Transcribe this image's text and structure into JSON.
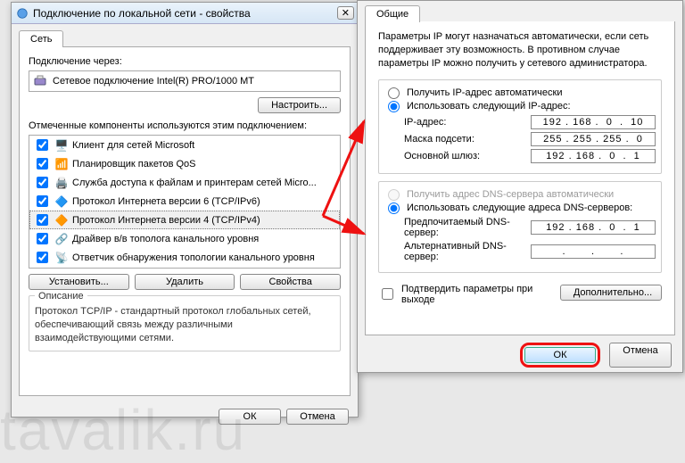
{
  "left": {
    "title": "Подключение по локальной сети - свойства",
    "tab": "Сеть",
    "connectThrough": "Подключение через:",
    "adapter": "Сетевое подключение Intel(R) PRO/1000 MT",
    "configure": "Настроить...",
    "componentsLabel": "Отмеченные компоненты используются этим подключением:",
    "items": [
      "Клиент для сетей Microsoft",
      "Планировщик пакетов QoS",
      "Служба доступа к файлам и принтерам сетей Micro...",
      "Протокол Интернета версии 6 (TCP/IPv6)",
      "Протокол Интернета версии 4 (TCP/IPv4)",
      "Драйвер в/в тополога канального уровня",
      "Ответчик обнаружения топологии канального уровня"
    ],
    "install": "Установить...",
    "uninstall": "Удалить",
    "properties": "Свойства",
    "descTitle": "Описание",
    "descText": "Протокол TCP/IP - стандартный протокол глобальных сетей, обеспечивающий связь между различными взаимодействующими сетями.",
    "ok": "ОК",
    "cancel": "Отмена"
  },
  "right": {
    "tab": "Общие",
    "info": "Параметры IP могут назначаться автоматически, если сеть поддерживает эту возможность. В противном случае параметры IP можно получить у сетевого администратора.",
    "autoIP": "Получить IP-адрес автоматически",
    "useIP": "Использовать следующий IP-адрес:",
    "ipLabel": "IP-адрес:",
    "ipVal": "192 . 168 .  0  .  10",
    "maskLabel": "Маска подсети:",
    "maskVal": "255 . 255 . 255 .  0",
    "gwLabel": "Основной шлюз:",
    "gwVal": "192 . 168 .  0  .  1",
    "autoDNS": "Получить адрес DNS-сервера автоматически",
    "useDNS": "Использовать следующие адреса DNS-серверов:",
    "dns1Label": "Предпочитаемый DNS-сервер:",
    "dns1Val": "192 . 168 .  0  .  1",
    "dns2Label": "Альтернативный DNS-сервер:",
    "dns2Val": " .       .       . ",
    "confirmExit": "Подтвердить параметры при выходе",
    "advanced": "Дополнительно...",
    "ok": "ОК",
    "cancel": "Отмена"
  },
  "watermark": "tavalik.ru"
}
